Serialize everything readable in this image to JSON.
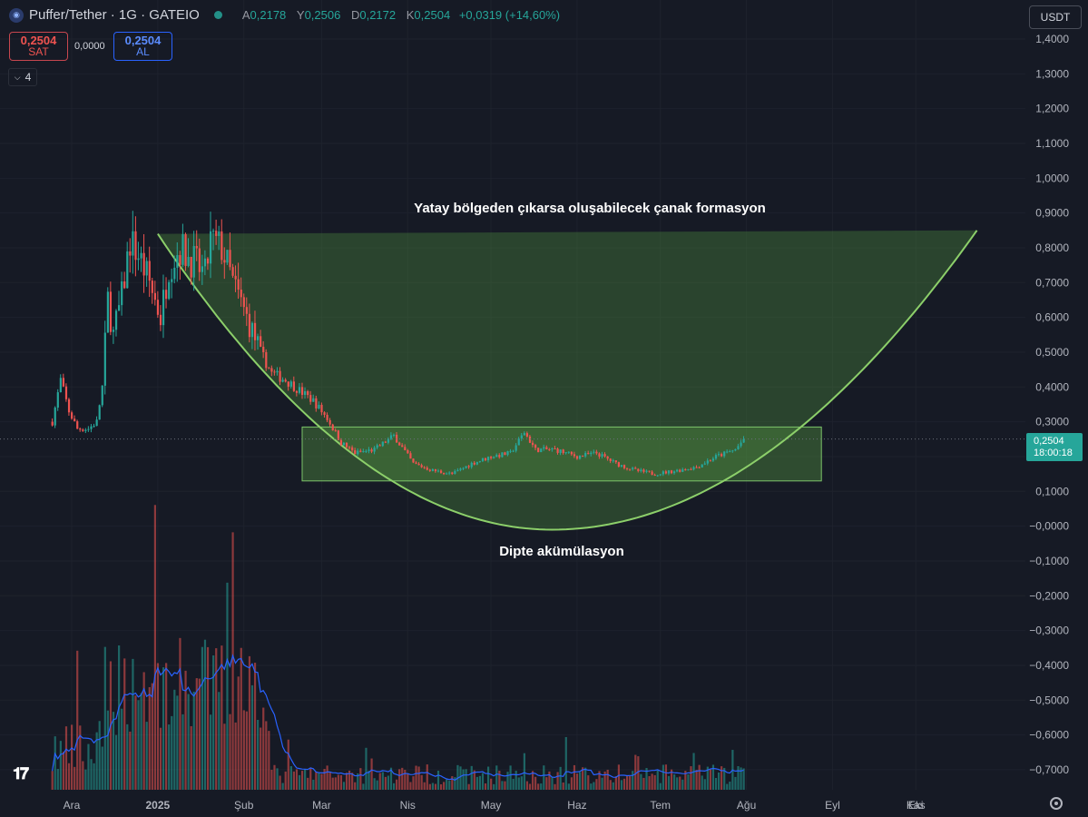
{
  "header": {
    "symbol": "Puffer/Tether · 1G · GATEIO",
    "ohlc": [
      {
        "k": "A",
        "v": "0,2178"
      },
      {
        "k": "Y",
        "v": "0,2506"
      },
      {
        "k": "D",
        "v": "0,2172"
      },
      {
        "k": "K",
        "v": "0,2504"
      },
      {
        "k": "",
        "v": "+0,0319 (+14,60%)"
      }
    ]
  },
  "trade": {
    "sell_price": "0,2504",
    "sell_label": "SAT",
    "spread": "0,0000",
    "buy_price": "0,2504",
    "buy_label": "AL"
  },
  "indicators_count": "4",
  "currency": "USDT",
  "colors": {
    "background": "#161a25",
    "up": "#26a69a",
    "down": "#ef5350",
    "zone_fill": "#4d8a3f",
    "curve": "#8ccf6a",
    "ma_line": "#2962ff"
  },
  "chart_data": {
    "type": "candlestick",
    "title": "",
    "y_axis": {
      "min": -0.75,
      "max": 1.45,
      "position": "right",
      "ticks": [
        "1,4000",
        "1,3000",
        "1,2000",
        "1,1000",
        "1,0000",
        "0,9000",
        "0,8000",
        "0,7000",
        "0,6000",
        "0,5000",
        "0,4000",
        "0,3000",
        "0,1000",
        "−0,0000",
        "−0,1000",
        "−0,2000",
        "−0,3000",
        "−0,4000",
        "−0,5000",
        "−0,6000",
        "−0,7000"
      ]
    },
    "x_axis": {
      "labels": [
        "Ara",
        "2025",
        "Şub",
        "Mar",
        "Nis",
        "May",
        "Haz",
        "Tem",
        "Ağu",
        "Eyl",
        "Eki",
        "Kas"
      ],
      "bold": [
        "2025"
      ]
    },
    "last_price": {
      "value": 0.2504,
      "label": "0,2504",
      "countdown": "18:00:18"
    },
    "price_path": [
      {
        "x": "Kas 24",
        "y": 0.3
      },
      {
        "x": "Kas 27",
        "y": 0.42
      },
      {
        "x": "Kas 30",
        "y": 0.33
      },
      {
        "x": "Ara 3",
        "y": 0.28
      },
      {
        "x": "Ara 7",
        "y": 0.28
      },
      {
        "x": "Ara 10",
        "y": 0.3
      },
      {
        "x": "Ara 12",
        "y": 0.4
      },
      {
        "x": "Ara 14",
        "y": 0.65
      },
      {
        "x": "Ara 16",
        "y": 0.55
      },
      {
        "x": "Ara 19",
        "y": 0.66
      },
      {
        "x": "Ara 22",
        "y": 0.82
      },
      {
        "x": "Ara 25",
        "y": 0.78
      },
      {
        "x": "Ara 29",
        "y": 0.7
      },
      {
        "x": "Oca 2",
        "y": 0.6
      },
      {
        "x": "Oca 5",
        "y": 0.75
      },
      {
        "x": "Oca 9",
        "y": 0.8
      },
      {
        "x": "Oca 14",
        "y": 0.76
      },
      {
        "x": "Oca 18",
        "y": 0.72
      },
      {
        "x": "Oca 20",
        "y": 0.82
      },
      {
        "x": "Oca 24",
        "y": 0.8
      },
      {
        "x": "Oca 28",
        "y": 0.7
      },
      {
        "x": "Şub 3",
        "y": 0.58
      },
      {
        "x": "Şub 7",
        "y": 0.5
      },
      {
        "x": "Şub 11",
        "y": 0.44
      },
      {
        "x": "Şub 16",
        "y": 0.42
      },
      {
        "x": "Şub 21",
        "y": 0.39
      },
      {
        "x": "Şub 26",
        "y": 0.36
      },
      {
        "x": "Mar 3",
        "y": 0.31
      },
      {
        "x": "Mar 8",
        "y": 0.24
      },
      {
        "x": "Mar 13",
        "y": 0.21
      },
      {
        "x": "Mar 20",
        "y": 0.22
      },
      {
        "x": "Mar 27",
        "y": 0.26
      },
      {
        "x": "Nis 3",
        "y": 0.18
      },
      {
        "x": "Nis 10",
        "y": 0.16
      },
      {
        "x": "Nis 17",
        "y": 0.15
      },
      {
        "x": "Nis 24",
        "y": 0.18
      },
      {
        "x": "May 1",
        "y": 0.2
      },
      {
        "x": "May 8",
        "y": 0.21
      },
      {
        "x": "May 13",
        "y": 0.27
      },
      {
        "x": "May 17",
        "y": 0.22
      },
      {
        "x": "May 24",
        "y": 0.22
      },
      {
        "x": "Haz 1",
        "y": 0.2
      },
      {
        "x": "Haz 8",
        "y": 0.21
      },
      {
        "x": "Haz 15",
        "y": 0.18
      },
      {
        "x": "Haz 22",
        "y": 0.16
      },
      {
        "x": "Haz 29",
        "y": 0.15
      },
      {
        "x": "Tem 7",
        "y": 0.16
      },
      {
        "x": "Tem 14",
        "y": 0.17
      },
      {
        "x": "Tem 21",
        "y": 0.2
      },
      {
        "x": "Tem 28",
        "y": 0.22
      },
      {
        "x": "Tem 31",
        "y": 0.2504
      }
    ],
    "annotations": {
      "cup_label": "Yatay bölgeden çıkarsa oluşabilecek çanak formasyon",
      "base_label": "Dipte akümülasyon",
      "accumulation_zone": {
        "x_start": "Şub 22",
        "x_end": "Ağu 28",
        "y_low": 0.13,
        "y_high": 0.285
      },
      "cup_curve": {
        "x_start": "Oca 1",
        "x_bottom": "May 23",
        "x_end": "Eki 23",
        "y_start": 0.84,
        "y_bottom": -0.01,
        "y_end": 0.85
      }
    }
  }
}
